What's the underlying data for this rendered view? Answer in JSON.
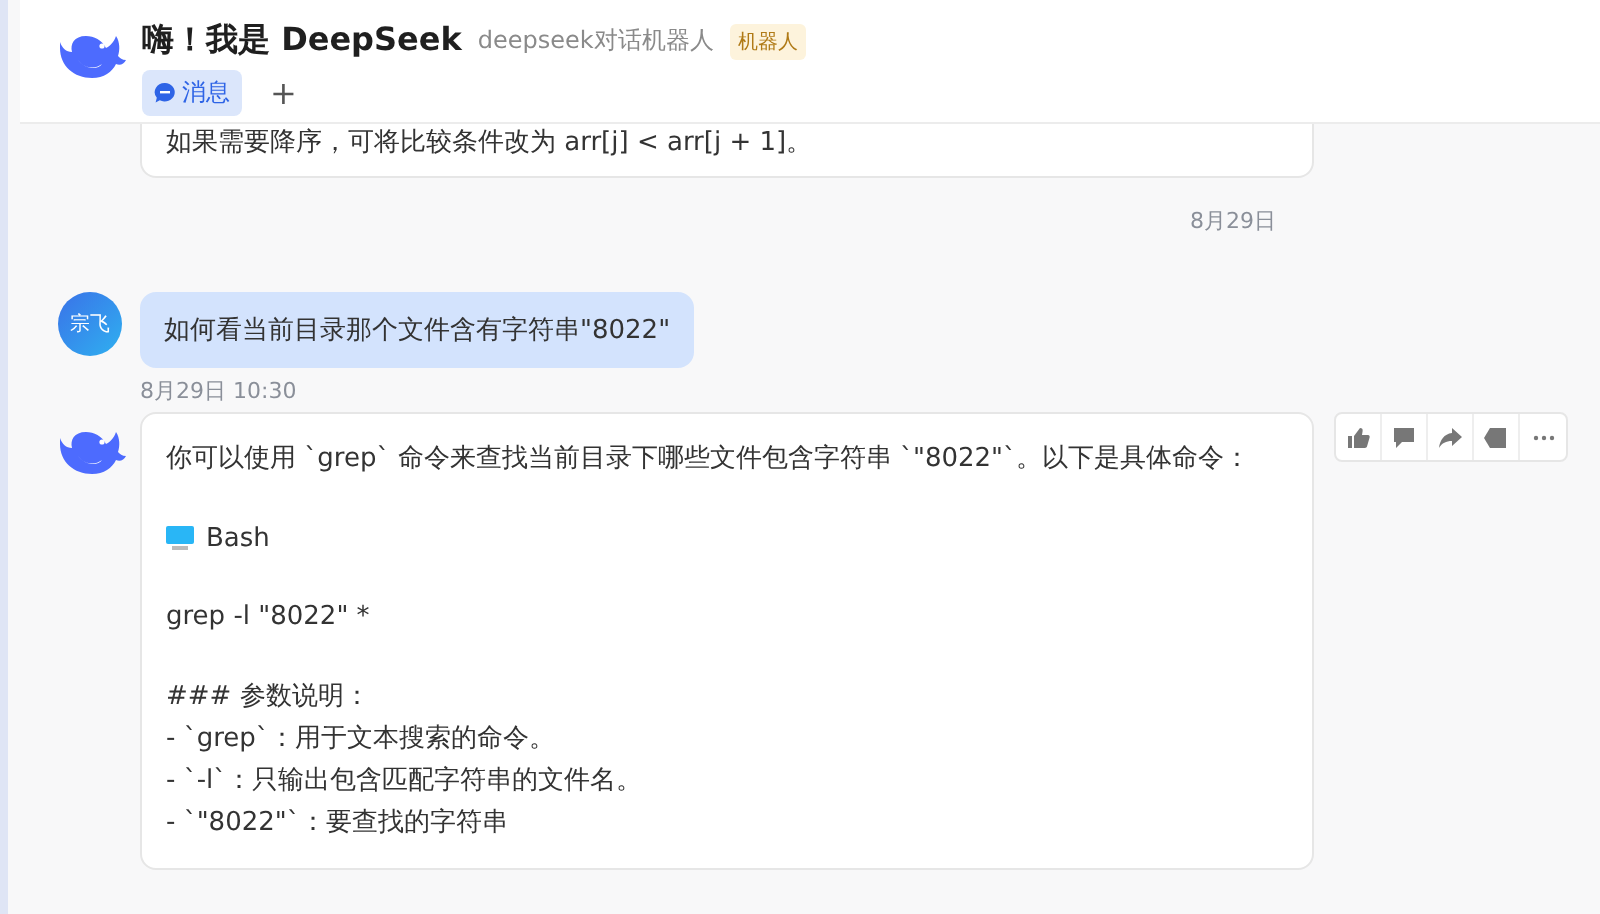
{
  "header": {
    "title": "嗨！我是 DeepSeek",
    "subtitle": "deepseek对话机器人",
    "badge": "机器人",
    "tabs": [
      {
        "label": "消息",
        "selected": true
      }
    ],
    "add_tab": "+"
  },
  "messages": [
    {
      "kind": "bot_tail",
      "text": "如果需要降序，可将比较条件改为 arr[j] < arr[j + 1]。"
    },
    {
      "kind": "date",
      "text": "8月29日"
    },
    {
      "kind": "user",
      "avatar": "宗飞",
      "text": "如何看当前目录那个文件含有字符串\"8022\"",
      "time": "8月29日 10:30"
    },
    {
      "kind": "bot",
      "lines": [
        {
          "kind": "text",
          "text": "你可以使用 `grep` 命令来查找当前目录下哪些文件包含字符串 `\"8022\"`。以下是具体命令："
        },
        {
          "kind": "blank"
        },
        {
          "kind": "code_lang",
          "text": "Bash"
        },
        {
          "kind": "text",
          "text": "grep -l \"8022\" *"
        },
        {
          "kind": "blank"
        },
        {
          "kind": "text",
          "text": "### 参数说明："
        },
        {
          "kind": "text",
          "text": "- `grep`：用于文本搜索的命令。"
        },
        {
          "kind": "text",
          "text": "- `-l`：只输出包含匹配字符串的文件名。"
        },
        {
          "kind": "text",
          "text": "- `\"8022\"`：要查找的字符串"
        }
      ]
    }
  ]
}
